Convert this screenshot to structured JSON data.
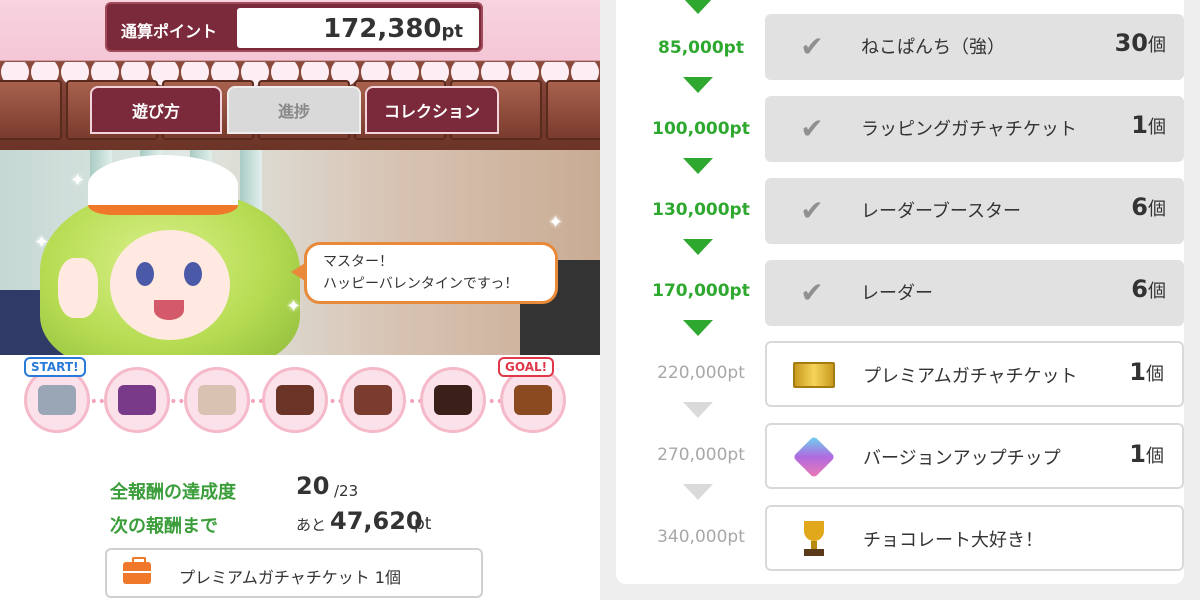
{
  "header": {
    "points_label": "通算ポイント",
    "points_value": "172,380",
    "points_unit": "pt"
  },
  "tabs": [
    {
      "label": "遊び方",
      "state": "active"
    },
    {
      "label": "進捗",
      "state": "disabled"
    },
    {
      "label": "コレクション",
      "state": "active"
    }
  ],
  "speech_bubble": {
    "line1": "マスター！",
    "line2": "ハッピーバレンタインですっ！"
  },
  "stage_track": {
    "start_label": "START!",
    "goal_label": "GOAL!",
    "stage_icons": [
      "telescope-icon",
      "wings-icon",
      "bowl-icon",
      "chocolate-hearts-icon",
      "bitten-chocolate-icon",
      "chocolate-cake-icon",
      "gift-box-icon"
    ]
  },
  "progress": {
    "completion_label": "全報酬の達成度",
    "completion_value": "20",
    "completion_total": "/23",
    "next_label": "次の報酬まで",
    "next_prefix": "あと",
    "next_value": "47,620",
    "next_unit": "pt"
  },
  "next_reward": {
    "icon": "bag-icon",
    "text": "プレミアムガチャチケット 1個"
  },
  "reward_list": [
    {
      "points": "85,000pt",
      "name": "ねこぱんち（強）",
      "qty": "30",
      "unit": "個",
      "status": "done",
      "icon": "check-icon"
    },
    {
      "points": "100,000pt",
      "name": "ラッピングガチャチケット",
      "qty": "1",
      "unit": "個",
      "status": "done",
      "icon": "check-icon"
    },
    {
      "points": "130,000pt",
      "name": "レーダーブースター",
      "qty": "6",
      "unit": "個",
      "status": "done",
      "icon": "check-icon"
    },
    {
      "points": "170,000pt",
      "name": "レーダー",
      "qty": "6",
      "unit": "個",
      "status": "done",
      "icon": "check-icon"
    },
    {
      "points": "220,000pt",
      "name": "プレミアムガチャチケット",
      "qty": "1",
      "unit": "個",
      "status": "todo",
      "icon": "ticket-icon"
    },
    {
      "points": "270,000pt",
      "name": "バージョンアップチップ",
      "qty": "1",
      "unit": "個",
      "status": "todo",
      "icon": "chip-icon"
    },
    {
      "points": "340,000pt",
      "name": "チョコレート大好き！",
      "qty": "",
      "unit": "",
      "status": "todo",
      "icon": "trophy-icon"
    }
  ],
  "colors": {
    "accent_green": "#2ea82e",
    "tab_maroon": "#7a2a3a",
    "done_grey": "#e1e1e1",
    "bubble_border": "#e88a3a"
  }
}
